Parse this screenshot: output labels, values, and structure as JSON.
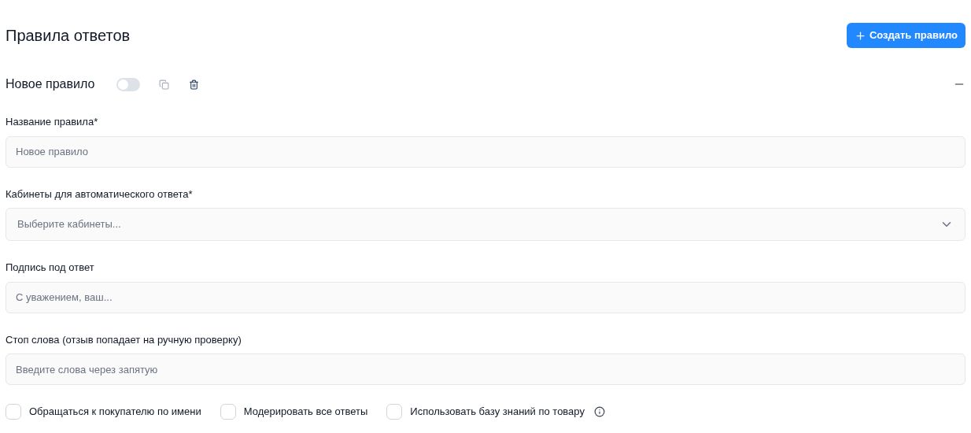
{
  "page": {
    "title": "Правила ответов",
    "create_button": "Создать правило"
  },
  "rule": {
    "name": "Новое правило",
    "on": false,
    "expanded": true,
    "fields": [
      {
        "kind": "text",
        "label": "Название правила*",
        "placeholder": "Новое правило"
      },
      {
        "kind": "select",
        "label": "Кабинеты для автоматического ответа*",
        "placeholder": "Выберите кабинеты..."
      },
      {
        "kind": "text",
        "label": "Подпись под ответ",
        "placeholder": "С уважением, ваш..."
      },
      {
        "kind": "text",
        "label": "Стоп слова (отзыв попадает на ручную проверку)",
        "placeholder": "Введите слова через запятую"
      }
    ],
    "options": [
      {
        "label": "Обращаться к покупателю по имени",
        "checked": false,
        "info": false
      },
      {
        "label": "Модерировать все ответы",
        "checked": false,
        "info": false
      },
      {
        "label": "Использовать базу знаний по товару",
        "checked": false,
        "info": true
      }
    ]
  }
}
